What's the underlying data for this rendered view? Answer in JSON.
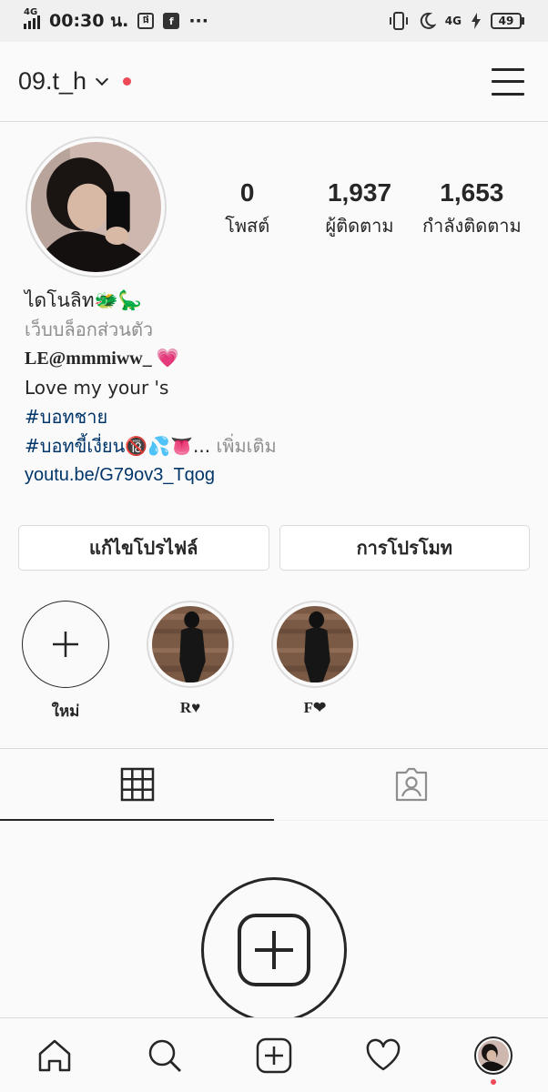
{
  "status_bar": {
    "network": "4G",
    "time": "00:30 น.",
    "more": "···",
    "right_network": "4G",
    "battery": "49"
  },
  "header": {
    "username": "09.t_h"
  },
  "profile": {
    "stats": [
      {
        "value": "0",
        "label": "โพสต์"
      },
      {
        "value": "1,937",
        "label": "ผู้ติดตาม"
      },
      {
        "value": "1,653",
        "label": "กำลังติดตาม"
      }
    ],
    "bio": {
      "name": "ไดโนลิท🐲🦕",
      "category": "เว็บบล็อกส่วนตัว",
      "mention": "LE@mmmiww_ 💗",
      "line": "Love my your 's",
      "hashtag1": "#บอทชาย",
      "hashtag2": "#บอทขี้เงี่ยน🔞💦👅",
      "ellipsis": "...",
      "more": "เพิ่มเติม",
      "link": "youtu.be/G79ov3_Tqog"
    },
    "buttons": {
      "edit": "แก้ไขโปรไฟล์",
      "promote": "การโปรโมท"
    }
  },
  "highlights": [
    {
      "label": "ใหม่"
    },
    {
      "label": "R♥"
    },
    {
      "label": "F❤"
    }
  ],
  "icons": {
    "grid": "grid-icon",
    "tagged": "tagged-icon",
    "home": "home-icon",
    "search": "search-icon",
    "new_post": "new-post-icon",
    "activity": "heart-icon"
  },
  "colors": {
    "notification_dot": "#ed4956",
    "link": "#003569",
    "secondary_text": "#8e8e8e"
  }
}
